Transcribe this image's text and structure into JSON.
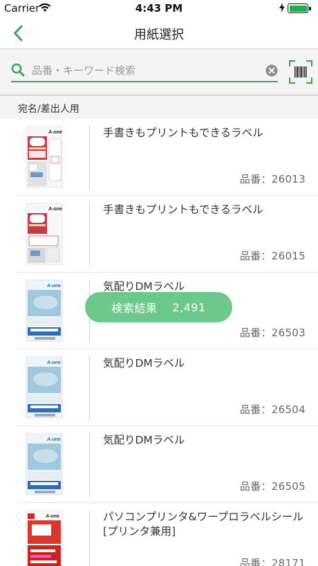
{
  "status_bar": {
    "carrier": "Carrier",
    "time": "4:43 PM"
  },
  "nav": {
    "title": "用紙選択"
  },
  "search": {
    "placeholder": "品番・キーワード検索",
    "value": ""
  },
  "section": {
    "label": "宛名/差出人用"
  },
  "code_prefix": "品番：",
  "products": [
    {
      "name": "手書きもプリントもできるラベル",
      "code": "26013",
      "thumb": "hand"
    },
    {
      "name": "手書きもプリントもできるラベル",
      "code": "26015",
      "thumb": "hand"
    },
    {
      "name": "気配りDMラベル",
      "code": "26503",
      "thumb": "dm"
    },
    {
      "name": "気配りDMラベル",
      "code": "26504",
      "thumb": "dm"
    },
    {
      "name": "気配りDMラベル",
      "code": "26505",
      "thumb": "dm"
    },
    {
      "name": "パソコンプリンタ&ワープロラベルシール[プリンタ兼用]",
      "code": "28171",
      "thumb": "pc"
    }
  ],
  "result": {
    "label": "検索結果",
    "count": "2,491"
  },
  "colors": {
    "accent": "#35a656",
    "badge": "#62c482",
    "battery": "#1ab24a"
  },
  "icons": {
    "back": "chevron-left-icon",
    "search": "search-icon",
    "clear": "clear-icon",
    "barcode": "barcode-scan-icon"
  }
}
